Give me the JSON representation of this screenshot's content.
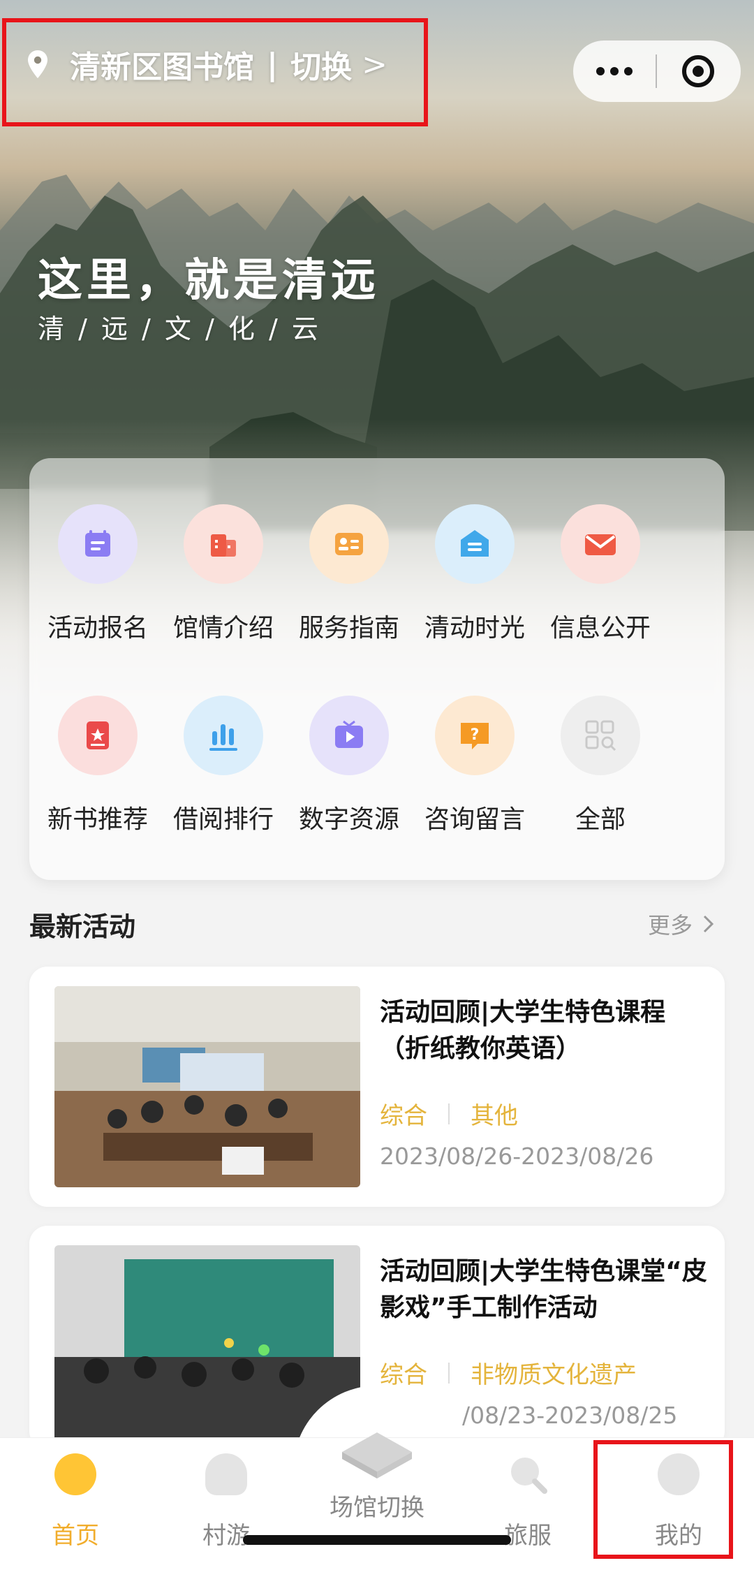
{
  "header": {
    "location_label": "清新区图书馆",
    "switch_label": "切换",
    "switch_arrow": ">"
  },
  "hero": {
    "title": "这里，就是清远",
    "subtitle": "清 / 远 / 文 / 化 / 云"
  },
  "menu": {
    "items": [
      {
        "label": "活动报名",
        "icon": "calendar-icon",
        "bg": "#e6e2fa",
        "fg": "#8b7cf3"
      },
      {
        "label": "馆情介绍",
        "icon": "building-icon",
        "bg": "#fbe1dc",
        "fg": "#ee5a45"
      },
      {
        "label": "服务指南",
        "icon": "id-card-icon",
        "bg": "#fde9d2",
        "fg": "#f5a340"
      },
      {
        "label": "清动时光",
        "icon": "envelope-doc-icon",
        "bg": "#dbeefb",
        "fg": "#40a8ea"
      },
      {
        "label": "信息公开",
        "icon": "mail-icon",
        "bg": "#fbe0dc",
        "fg": "#ef5a44"
      },
      {
        "label": "新书推荐",
        "icon": "book-star-icon",
        "bg": "#fbdedd",
        "fg": "#ea4a4a"
      },
      {
        "label": "借阅排行",
        "icon": "bar-chart-icon",
        "bg": "#dbeefb",
        "fg": "#3ea0ea"
      },
      {
        "label": "数字资源",
        "icon": "tv-play-icon",
        "bg": "#e6e2fa",
        "fg": "#8b7cf3"
      },
      {
        "label": "咨询留言",
        "icon": "question-bubble-icon",
        "bg": "#fde9d2",
        "fg": "#f59a24"
      },
      {
        "label": "全部",
        "icon": "grid-search-icon",
        "bg": "#eeeeee",
        "fg": "#c9c9c9"
      }
    ]
  },
  "section": {
    "title": "最新活动",
    "more_label": "更多"
  },
  "activities": [
    {
      "title": "活动回顾|大学生特色课程（折纸教你英语）",
      "tags": [
        "综合",
        "其他"
      ],
      "date": "2023/08/26-2023/08/26"
    },
    {
      "title": "活动回顾|大学生特色课堂“皮影戏”手工制作活动",
      "tags": [
        "综合",
        "非物质文化遗产"
      ],
      "date": "/08/23-2023/08/25"
    }
  ],
  "tabbar": {
    "items": [
      {
        "label": "首页",
        "icon": "home-face-icon",
        "active": true
      },
      {
        "label": "村游",
        "icon": "cloud-icon",
        "active": false
      },
      {
        "label": "场馆切换",
        "icon": "building-switch-icon",
        "active": false
      },
      {
        "label": "旅服",
        "icon": "search-icon",
        "active": false
      },
      {
        "label": "我的",
        "icon": "user-icon",
        "active": false
      }
    ]
  },
  "colors": {
    "accent": "#f1ad2c",
    "tag": "#e4b43c",
    "highlight": "#e8141a"
  }
}
